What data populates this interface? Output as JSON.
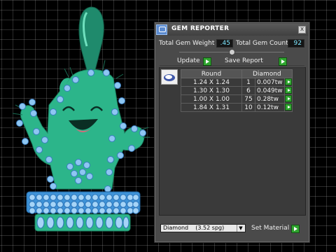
{
  "panel": {
    "title": "GEM REPORTER",
    "close_symbol": "x",
    "total_gem_weight_label": "Total Gem Weight",
    "total_gem_weight": ".45",
    "total_gem_count_label": "Total Gem Count",
    "total_gem_count": "92",
    "update_label": "Update",
    "save_report_label": "Save Report",
    "table": {
      "columns": [
        "Round",
        "Diamond"
      ],
      "rows": [
        {
          "size": "1.24 X 1.24",
          "count": "1",
          "weight": "0.007tw"
        },
        {
          "size": "1.30 X 1.30",
          "count": "6",
          "weight": "0.049tw"
        },
        {
          "size": "1.00 X 1.00",
          "count": "75",
          "weight": "0.28tw"
        },
        {
          "size": "1.84 X 1.31",
          "count": "10",
          "weight": "0.12tw"
        }
      ]
    },
    "material_select": "Diamond    (3.52 spg)",
    "set_material_label": "Set Material"
  },
  "colors": {
    "cactus": "#2cb58a",
    "gem": "#8ec6f2",
    "accent": "#7fe7ff",
    "go_button": "#2fa52f"
  }
}
